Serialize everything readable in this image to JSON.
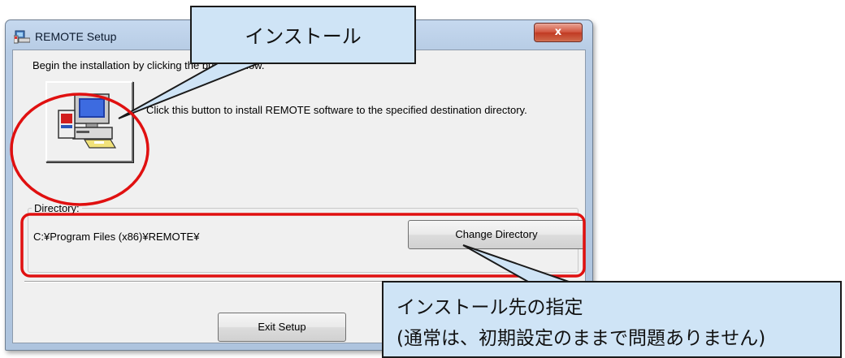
{
  "window": {
    "title": "REMOTE Setup",
    "close_glyph": "x"
  },
  "instructions": "Begin the installation by clicking the button below.",
  "install": {
    "description": "Click this button to install REMOTE software to the specified destination directory.",
    "icon": "computer-install-icon"
  },
  "directory": {
    "group_label": "Directory:",
    "path": "C:¥Program Files (x86)¥REMOTE¥",
    "change_button": "Change Directory"
  },
  "exit_button": "Exit Setup",
  "annotations": {
    "install_callout": "インストール",
    "directory_callout_line1": "インストール先の指定",
    "directory_callout_line2": "(通常は、初期設定のままで問題ありません)",
    "highlight_color": "#e01010",
    "callout_fill": "#cfe4f6"
  }
}
